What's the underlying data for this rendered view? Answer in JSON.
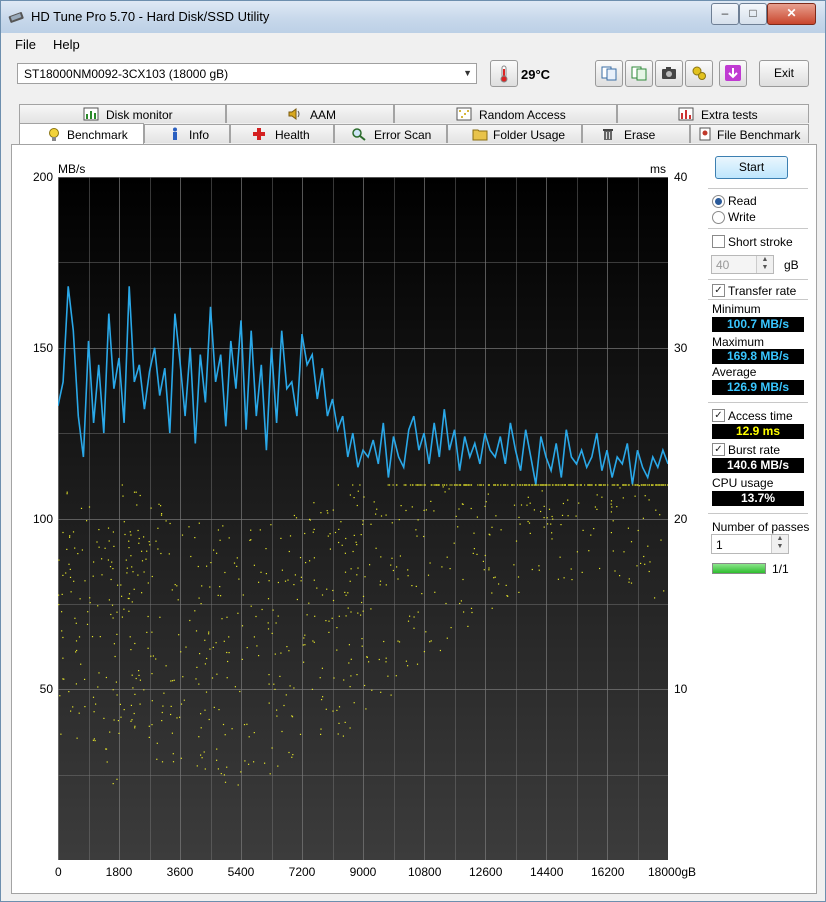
{
  "window": {
    "title": "HD Tune Pro 5.70 - Hard Disk/SSD Utility",
    "minimize": "–",
    "maximize": "□",
    "close": "✕"
  },
  "menu": {
    "file": "File",
    "help": "Help"
  },
  "toolbar": {
    "drive": "ST18000NM0092-3CX103 (18000 gB)",
    "temperature": "29°C",
    "exit_label": "Exit"
  },
  "tabs_top": [
    "Disk monitor",
    "AAM",
    "Random Access",
    "Extra tests"
  ],
  "tabs_bottom": [
    "Benchmark",
    "Info",
    "Health",
    "Error Scan",
    "Folder Usage",
    "Erase",
    "File Benchmark"
  ],
  "active_tab": "Benchmark",
  "side": {
    "start_label": "Start",
    "read_label": "Read",
    "write_label": "Write",
    "short_stroke_label": "Short stroke",
    "short_stroke_value": "40",
    "short_stroke_unit": "gB",
    "transfer_rate_label": "Transfer rate",
    "minimum_label": "Minimum",
    "minimum_value": "100.7 MB/s",
    "maximum_label": "Maximum",
    "maximum_value": "169.8 MB/s",
    "average_label": "Average",
    "average_value": "126.9 MB/s",
    "access_time_label": "Access time",
    "access_time_value": "12.9 ms",
    "burst_rate_label": "Burst rate",
    "burst_rate_value": "140.6 MB/s",
    "cpu_usage_label": "CPU usage",
    "cpu_usage_value": "13.7%",
    "passes_label": "Number of passes",
    "passes_value": "1",
    "progress_text": "1/1",
    "progress_fraction": 1.0
  },
  "colors": {
    "transfer_line": "#2aa8e8",
    "access_dots": "#e6e62a",
    "min_max_avg_text": "#39c6ff",
    "access_burst_cpu_text_1": "#ffff00",
    "access_burst_cpu_text_2": "#ffffff"
  },
  "chart_data": {
    "type": "line",
    "left_axis_unit": "MB/s",
    "right_axis_unit": "ms",
    "x_unit": "gB",
    "y_ticks_left": [
      "200",
      "150",
      "100",
      "50"
    ],
    "y_ticks_right": [
      "40",
      "30",
      "20",
      "10"
    ],
    "x_ticks": [
      "0",
      "1800",
      "3600",
      "5400",
      "7200",
      "9000",
      "10800",
      "12600",
      "14400",
      "16200",
      "18000gB"
    ],
    "xlim": [
      0,
      18000
    ],
    "ylim_left": [
      0,
      200
    ],
    "ylim_right": [
      0,
      40
    ],
    "grid": true,
    "series": [
      {
        "x": [
          0,
          150,
          300,
          450,
          600,
          750,
          900,
          1050,
          1200,
          1350,
          1500,
          1650,
          1800,
          1950,
          2100,
          2250,
          2400,
          2550,
          2700,
          2850,
          3000,
          3150,
          3300,
          3450,
          3600,
          3750,
          3900,
          4050,
          4200,
          4350,
          4500,
          4650,
          4800,
          4950,
          5100,
          5250,
          5400,
          5550,
          5700,
          5850,
          6000,
          6150,
          6300,
          6450,
          6600,
          6750,
          6900,
          7050,
          7200,
          7350,
          7500,
          7650,
          7800,
          7950,
          8100,
          8250,
          8400,
          8550,
          8700,
          8850,
          9000,
          9150,
          9300,
          9450,
          9600,
          9750,
          9900,
          10050,
          10200,
          10350,
          10500,
          10650,
          10800,
          10950,
          11100,
          11250,
          11400,
          11550,
          11700,
          11850,
          12000,
          12150,
          12300,
          12450,
          12600,
          12750,
          12900,
          13050,
          13200,
          13350,
          13500,
          13650,
          13800,
          13950,
          14100,
          14250,
          14400,
          14550,
          14700,
          14850,
          15000,
          15150,
          15300,
          15450,
          15600,
          15750,
          15900,
          16050,
          16200,
          16350,
          16500,
          16650,
          16800,
          16950,
          17100,
          17250,
          17400,
          17550,
          17700,
          17850,
          18000
        ],
        "values": [
          133,
          140,
          168,
          155,
          130,
          118,
          152,
          128,
          145,
          125,
          160,
          138,
          147,
          128,
          168,
          140,
          145,
          132,
          143,
          150,
          136,
          144,
          125,
          160,
          146,
          130,
          150,
          122,
          148,
          134,
          162,
          140,
          148,
          127,
          152,
          138,
          158,
          126,
          155,
          130,
          145,
          120,
          150,
          128,
          155,
          138,
          140,
          130,
          154,
          145,
          148,
          135,
          144,
          130,
          135,
          126,
          130,
          118,
          125,
          115,
          120,
          118,
          123,
          116,
          128,
          112,
          124,
          118,
          115,
          126,
          130,
          120,
          125,
          116,
          128,
          118,
          132,
          120,
          126,
          114,
          124,
          118,
          122,
          116,
          125,
          120,
          118,
          124,
          116,
          128,
          120,
          114,
          126,
          118,
          110,
          124,
          118,
          114,
          122,
          112,
          126,
          118,
          116,
          120,
          115,
          118,
          125,
          114,
          120,
          112,
          118,
          116,
          122,
          110,
          120,
          115,
          112,
          118,
          115,
          120,
          116
        ]
      }
    ]
  }
}
